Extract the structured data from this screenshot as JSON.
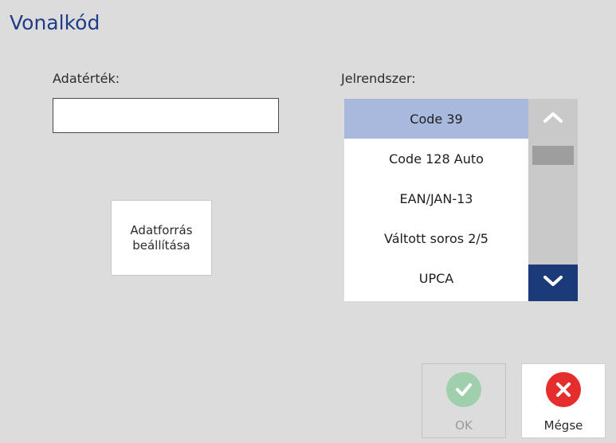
{
  "dialog": {
    "title": "Vonalkód"
  },
  "data_value": {
    "label": "Adatérték:",
    "value": ""
  },
  "data_source_button": {
    "label": "Adatforrás\nbeállítása"
  },
  "symbology": {
    "label": "Jelrendszer:",
    "selected_index": 0,
    "options": [
      "Code 39",
      "Code 128 Auto",
      "EAN/JAN-13",
      "Váltott soros 2/5",
      "UPCA"
    ]
  },
  "buttons": {
    "ok_label": "OK",
    "cancel_label": "Mégse"
  },
  "icons": {
    "scroll_up": "chevron-up-icon",
    "scroll_down": "chevron-down-icon",
    "ok": "check-circle-icon",
    "cancel": "x-circle-icon"
  },
  "colors": {
    "title": "#1f3c88",
    "selected_item": "#a9b9de",
    "scroll_down_bg": "#1a3a7a",
    "ok_icon": "#9fcfac",
    "cancel_icon": "#e62d2d"
  }
}
